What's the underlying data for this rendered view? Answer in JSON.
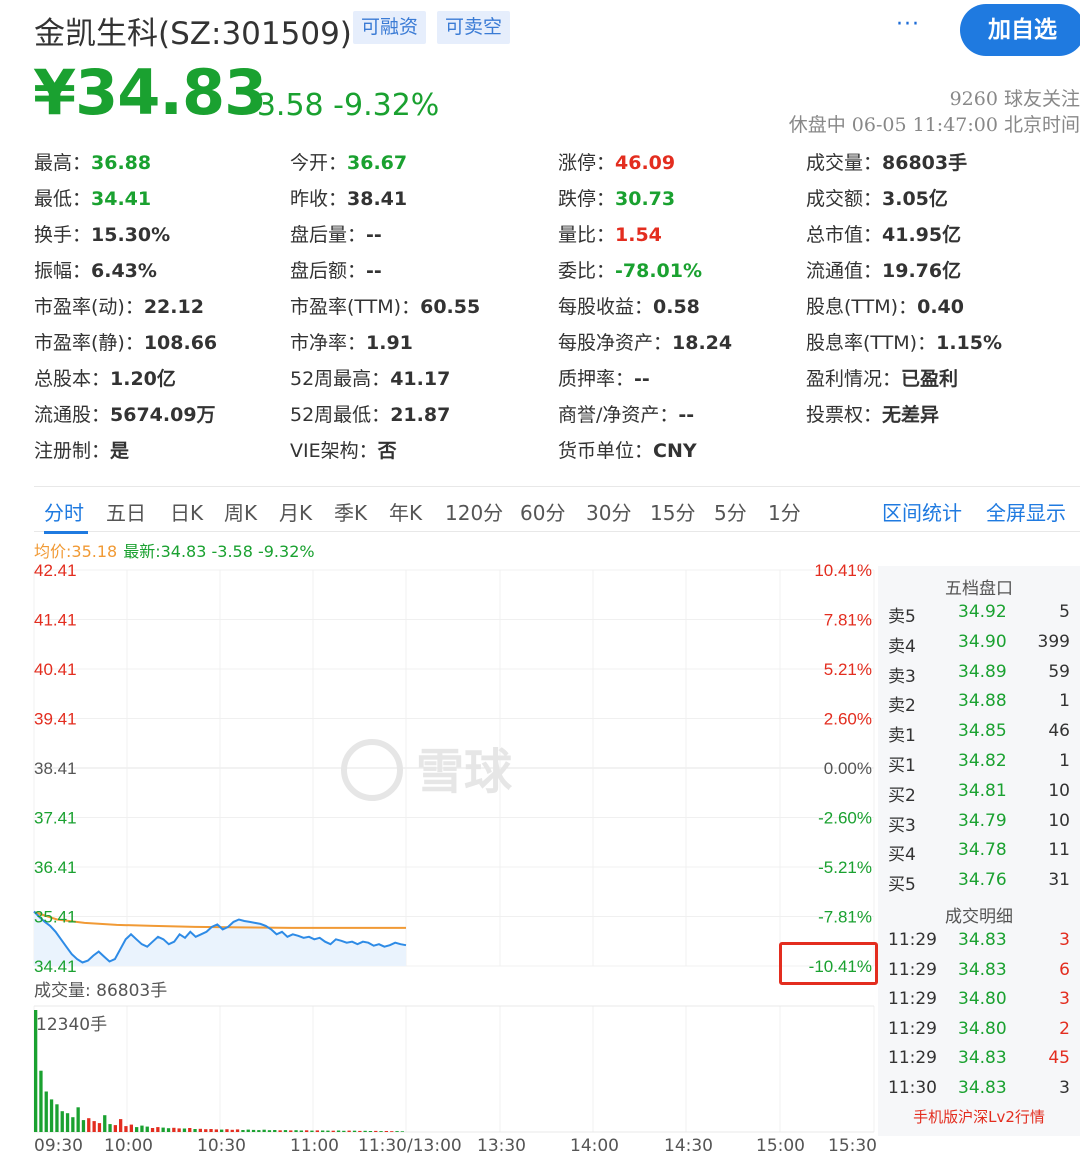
{
  "header": {
    "stock_name": "金凯生科(SZ:301509)",
    "tags": [
      "可融资",
      "可卖空"
    ],
    "more_label": "···",
    "follow_button": "加自选"
  },
  "quote": {
    "price": "¥34.83",
    "change": "-3.58 -9.32%",
    "followers": "9260 球友关注",
    "status": "休盘中 06-05 11:47:00 北京时间"
  },
  "stats": [
    {
      "label": "最高：",
      "value": "36.88",
      "color": "green"
    },
    {
      "label": "今开：",
      "value": "36.67",
      "color": "green"
    },
    {
      "label": "涨停：",
      "value": "46.09",
      "color": "red"
    },
    {
      "label": "成交量：",
      "value": "86803手",
      "color": "default"
    },
    {
      "label": "最低：",
      "value": "34.41",
      "color": "green"
    },
    {
      "label": "昨收：",
      "value": "38.41",
      "color": "default"
    },
    {
      "label": "跌停：",
      "value": "30.73",
      "color": "green"
    },
    {
      "label": "成交额：",
      "value": "3.05亿",
      "color": "default"
    },
    {
      "label": "换手：",
      "value": "15.30%",
      "color": "default"
    },
    {
      "label": "盘后量：",
      "value": "--",
      "color": "default"
    },
    {
      "label": "量比：",
      "value": "1.54",
      "color": "red"
    },
    {
      "label": "总市值：",
      "value": "41.95亿",
      "color": "default"
    },
    {
      "label": "振幅：",
      "value": "6.43%",
      "color": "default"
    },
    {
      "label": "盘后额：",
      "value": "--",
      "color": "default"
    },
    {
      "label": "委比：",
      "value": "-78.01%",
      "color": "green"
    },
    {
      "label": "流通值：",
      "value": "19.76亿",
      "color": "default"
    },
    {
      "label": "市盈率(动)：",
      "value": "22.12",
      "color": "default"
    },
    {
      "label": "市盈率(TTM)：",
      "value": "60.55",
      "color": "default"
    },
    {
      "label": "每股收益：",
      "value": "0.58",
      "color": "default"
    },
    {
      "label": "股息(TTM)：",
      "value": "0.40",
      "color": "default"
    },
    {
      "label": "市盈率(静)：",
      "value": "108.66",
      "color": "default"
    },
    {
      "label": "市净率：",
      "value": "1.91",
      "color": "default"
    },
    {
      "label": "每股净资产：",
      "value": "18.24",
      "color": "default"
    },
    {
      "label": "股息率(TTM)：",
      "value": "1.15%",
      "color": "default"
    },
    {
      "label": "总股本：",
      "value": "1.20亿",
      "color": "default"
    },
    {
      "label": "52周最高：",
      "value": "41.17",
      "color": "default"
    },
    {
      "label": "质押率：",
      "value": "--",
      "color": "default"
    },
    {
      "label": "盈利情况：",
      "value": "已盈利",
      "color": "default"
    },
    {
      "label": "流通股：",
      "value": "5674.09万",
      "color": "default"
    },
    {
      "label": "52周最低：",
      "value": "21.87",
      "color": "default"
    },
    {
      "label": "商誉/净资产：",
      "value": "--",
      "color": "default"
    },
    {
      "label": "投票权：",
      "value": "无差异",
      "color": "default"
    },
    {
      "label": "注册制：",
      "value": "是",
      "color": "default"
    },
    {
      "label": "VIE架构：",
      "value": "否",
      "color": "default"
    },
    {
      "label": "货币单位：",
      "value": "CNY",
      "color": "default"
    }
  ],
  "tabs": [
    "分时",
    "五日",
    "日K",
    "周K",
    "月K",
    "季K",
    "年K",
    "120分",
    "60分",
    "30分",
    "15分",
    "5分",
    "1分"
  ],
  "tab_links": [
    "区间统计",
    "全屏显示"
  ],
  "chart_info": {
    "avg_price": "均价:35.18",
    "latest": "最新:34.83 -3.58 -9.32%",
    "volume_label": "成交量: 86803手",
    "volume_max_label": "12340手",
    "watermark": "雪球"
  },
  "orderbook": {
    "title": "五档盘口",
    "asks": [
      {
        "label": "卖5",
        "price": "34.92",
        "vol": "5"
      },
      {
        "label": "卖4",
        "price": "34.90",
        "vol": "399"
      },
      {
        "label": "卖3",
        "price": "34.89",
        "vol": "59"
      },
      {
        "label": "卖2",
        "price": "34.88",
        "vol": "1"
      },
      {
        "label": "卖1",
        "price": "34.85",
        "vol": "46"
      }
    ],
    "bids": [
      {
        "label": "买1",
        "price": "34.82",
        "vol": "1"
      },
      {
        "label": "买2",
        "price": "34.81",
        "vol": "10"
      },
      {
        "label": "买3",
        "price": "34.79",
        "vol": "10"
      },
      {
        "label": "买4",
        "price": "34.78",
        "vol": "11"
      },
      {
        "label": "买5",
        "price": "34.76",
        "vol": "31"
      }
    ],
    "trades_title": "成交明细",
    "trades": [
      {
        "time": "11:29",
        "price": "34.83",
        "vol": "3"
      },
      {
        "time": "11:29",
        "price": "34.83",
        "vol": "6"
      },
      {
        "time": "11:29",
        "price": "34.80",
        "vol": "3"
      },
      {
        "time": "11:29",
        "price": "34.80",
        "vol": "2"
      },
      {
        "time": "11:29",
        "price": "34.83",
        "vol": "45"
      },
      {
        "time": "11:30",
        "price": "34.83",
        "vol": "3"
      }
    ],
    "footer": "手机版沪深Lv2行情"
  },
  "colors": {
    "up": "#e32d1f",
    "down": "#1aa130",
    "accent": "#1f7ae0",
    "avg_line": "#f19a35",
    "price_line": "#2e8be6"
  },
  "chart_data": {
    "type": "line",
    "price_ticks": [
      "42.41",
      "41.41",
      "40.41",
      "39.41",
      "38.41",
      "37.41",
      "36.41",
      "35.41",
      "34.41"
    ],
    "pct_ticks": [
      "10.41%",
      "7.81%",
      "5.21%",
      "2.60%",
      "0.00%",
      "-2.60%",
      "-5.21%",
      "-7.81%",
      "-10.41%"
    ],
    "x_ticks": [
      "09:30",
      "10:00",
      "10:30",
      "11:00",
      "11:30/13:00",
      "13:30",
      "14:00",
      "14:30",
      "15:00",
      "15:30"
    ],
    "ylim": [
      34.41,
      42.41
    ],
    "prev_close": 38.41,
    "session_minutes": 240,
    "price": [
      35.51,
      35.4,
      35.3,
      35.22,
      35.1,
      34.95,
      34.8,
      34.65,
      34.55,
      34.48,
      34.52,
      34.62,
      34.7,
      34.6,
      34.5,
      34.55,
      34.75,
      34.95,
      35.05,
      34.95,
      34.85,
      34.8,
      34.9,
      35.0,
      34.95,
      34.85,
      34.9,
      35.05,
      34.98,
      35.1,
      35.0,
      35.05,
      35.1,
      35.2,
      35.25,
      35.15,
      35.2,
      35.3,
      35.35,
      35.32,
      35.3,
      35.28,
      35.26,
      35.22,
      35.15,
      35.05,
      35.1,
      35.0,
      35.05,
      35.02,
      34.98,
      35.0,
      34.95,
      34.98,
      34.9,
      34.85,
      34.95,
      34.92,
      34.88,
      34.9,
      34.85,
      34.9,
      34.88,
      34.82,
      34.85,
      34.8,
      34.83,
      34.88,
      34.85,
      34.83
    ],
    "avg": [
      35.5,
      35.35,
      35.28,
      35.24,
      35.22,
      35.2,
      35.19,
      35.18,
      35.18,
      35.18
    ],
    "volume": [
      12340,
      6200,
      4100,
      3300,
      2800,
      2100,
      1900,
      1500,
      2500,
      1200,
      1400,
      1100,
      900,
      1700,
      800,
      700,
      1300,
      600,
      750,
      500,
      650,
      550,
      400,
      500,
      450,
      380,
      420,
      360,
      350,
      400,
      300,
      320,
      280,
      300,
      260,
      240,
      280,
      220,
      260,
      200,
      240,
      210,
      190,
      230,
      180,
      200,
      170,
      190,
      160,
      180,
      150,
      170,
      140,
      160,
      150,
      140,
      130,
      150,
      120,
      140,
      130,
      110,
      120,
      100,
      110,
      90,
      100,
      80,
      90,
      70
    ]
  }
}
